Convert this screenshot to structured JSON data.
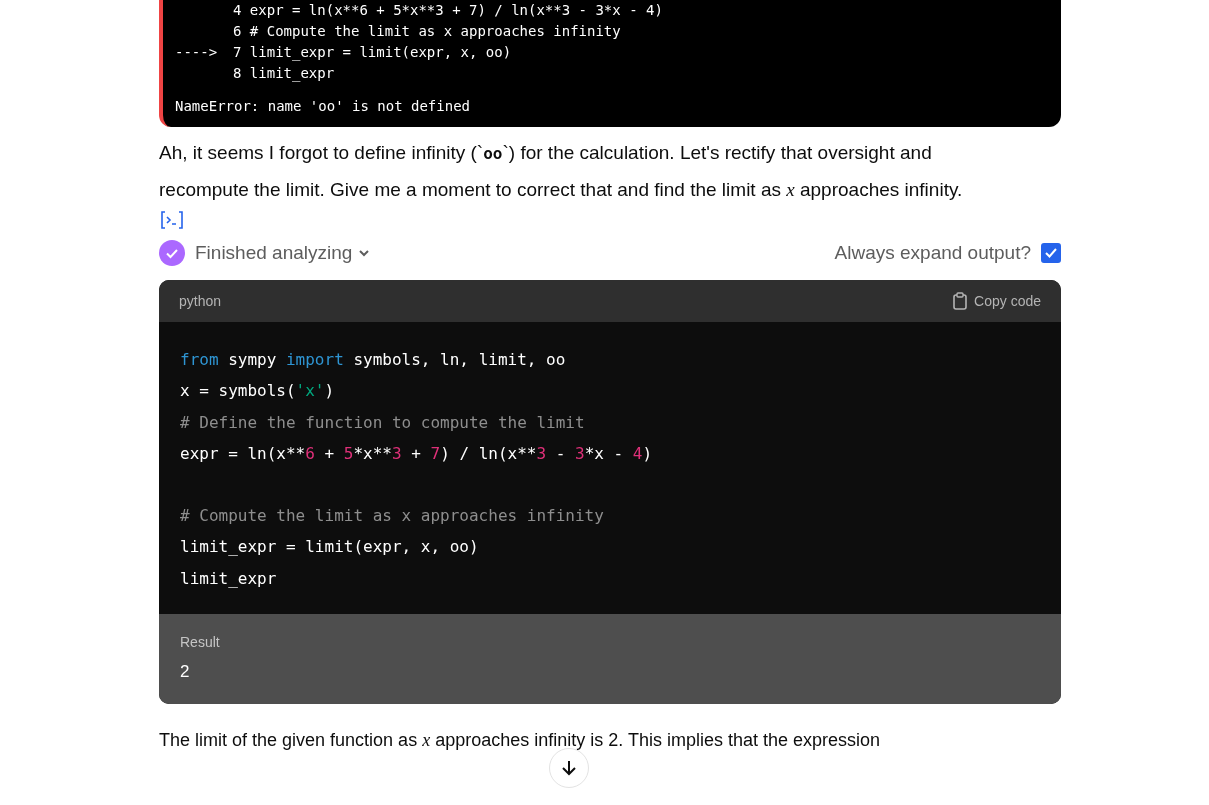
{
  "error_output": {
    "lines": [
      {
        "text": "4 expr = ln(x**6 + 5*x**3 + 7) / ln(x**3 - 3*x - 4)"
      },
      {
        "text": "6 # Compute the limit as x approaches infinity"
      },
      {
        "marker": "---->",
        "text": "7 limit_expr = limit(expr, x, oo)"
      },
      {
        "text": "8 limit_expr"
      }
    ],
    "error": "NameError: name 'oo' is not defined"
  },
  "message": [
    "Ah, it seems I forgot to define infinity (`**oo**`) for the calculation. Let's rectify that oversight and recompute the limit. Give me a moment to correct that and find the limit as *x* approaches infinity."
  ],
  "analysis": {
    "status": "Finished analyzing",
    "expanded": false,
    "expand_label": "Always expand output?",
    "expand_checked": true
  },
  "code_block": {
    "language": "python",
    "copy_label": "Copy code",
    "blocks": [
      [
        [
          {
            "kind": "keyword",
            "text": "from"
          },
          {
            "kind": "plain",
            "text": " sympy "
          },
          {
            "kind": "keyword",
            "text": "import"
          },
          {
            "kind": "plain",
            "text": " symbols, ln, limit, oo"
          }
        ],
        [
          {
            "kind": "plain",
            "text": "x = symbols("
          },
          {
            "kind": "string",
            "text": "'x'"
          },
          {
            "kind": "plain",
            "text": ")"
          }
        ],
        [
          {
            "kind": "comment",
            "text": "# Define the function to compute the limit"
          }
        ],
        [
          {
            "kind": "plain",
            "text": "expr = ln(x**"
          },
          {
            "kind": "number",
            "text": "6"
          },
          {
            "kind": "plain",
            "text": " + "
          },
          {
            "kind": "number",
            "text": "5"
          },
          {
            "kind": "plain",
            "text": "*x**"
          },
          {
            "kind": "number",
            "text": "3"
          },
          {
            "kind": "plain",
            "text": " + "
          },
          {
            "kind": "number",
            "text": "7"
          },
          {
            "kind": "plain",
            "text": ") / ln(x**"
          },
          {
            "kind": "number",
            "text": "3"
          },
          {
            "kind": "plain",
            "text": " - "
          },
          {
            "kind": "number",
            "text": "3"
          },
          {
            "kind": "plain",
            "text": "*x - "
          },
          {
            "kind": "number",
            "text": "4"
          },
          {
            "kind": "plain",
            "text": ")"
          }
        ]
      ],
      [
        [
          {
            "kind": "comment",
            "text": "# Compute the limit as x approaches infinity"
          }
        ],
        [
          {
            "kind": "plain",
            "text": "limit_expr = limit(expr, x, oo)"
          }
        ],
        [
          {
            "kind": "plain",
            "text": "limit_expr"
          }
        ]
      ]
    ],
    "result_label": "Result",
    "result": "2"
  },
  "answer": "The limit of the given function as *x* approaches infinity is 2. This implies that the expression"
}
